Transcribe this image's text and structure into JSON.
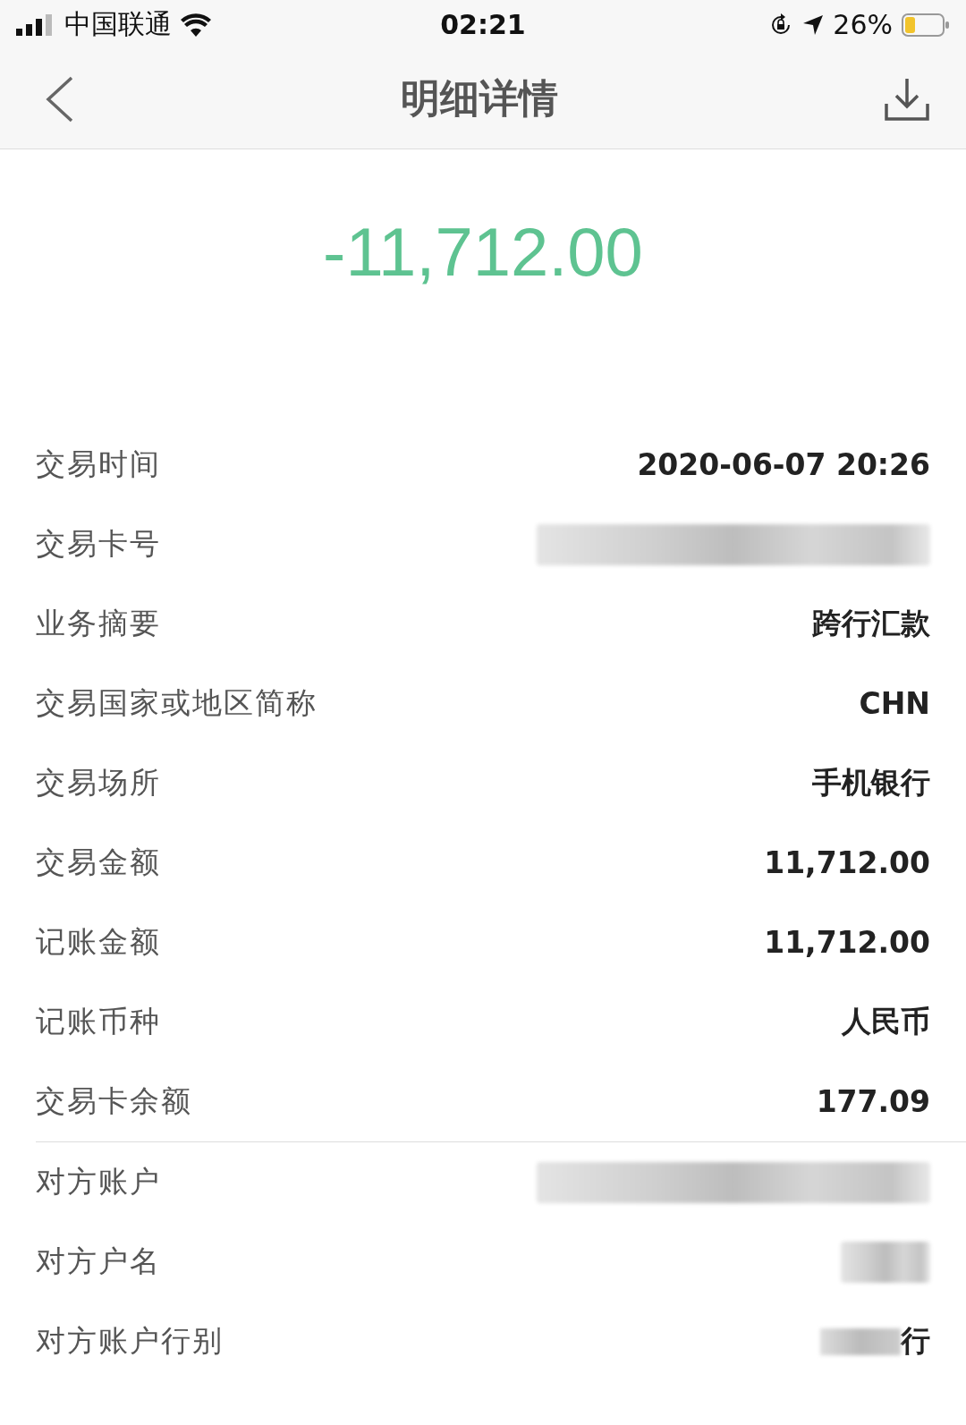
{
  "status_bar": {
    "carrier": "中国联通",
    "time": "02:21",
    "battery": "26%"
  },
  "nav": {
    "title": "明细详情"
  },
  "amount": "-11,712.00",
  "rows": [
    {
      "label": "交易时间",
      "kind": "text",
      "value": "2020-06-07 20:26"
    },
    {
      "label": "交易卡号",
      "kind": "redacted"
    },
    {
      "label": "业务摘要",
      "kind": "text",
      "value": "跨行汇款"
    },
    {
      "label": "交易国家或地区简称",
      "kind": "text",
      "value": "CHN"
    },
    {
      "label": "交易场所",
      "kind": "text",
      "value": "手机银行"
    },
    {
      "label": "交易金额",
      "kind": "text",
      "value": "11,712.00"
    },
    {
      "label": "记账金额",
      "kind": "text",
      "value": "11,712.00"
    },
    {
      "label": "记账币种",
      "kind": "text",
      "value": "人民币"
    },
    {
      "label": "交易卡余额",
      "kind": "text",
      "value": "177.09",
      "divider_after": true
    },
    {
      "label": "对方账户",
      "kind": "redacted"
    },
    {
      "label": "对方户名",
      "kind": "redacted",
      "short": true
    },
    {
      "label": "对方账户行别",
      "kind": "partial",
      "value": "行"
    }
  ]
}
